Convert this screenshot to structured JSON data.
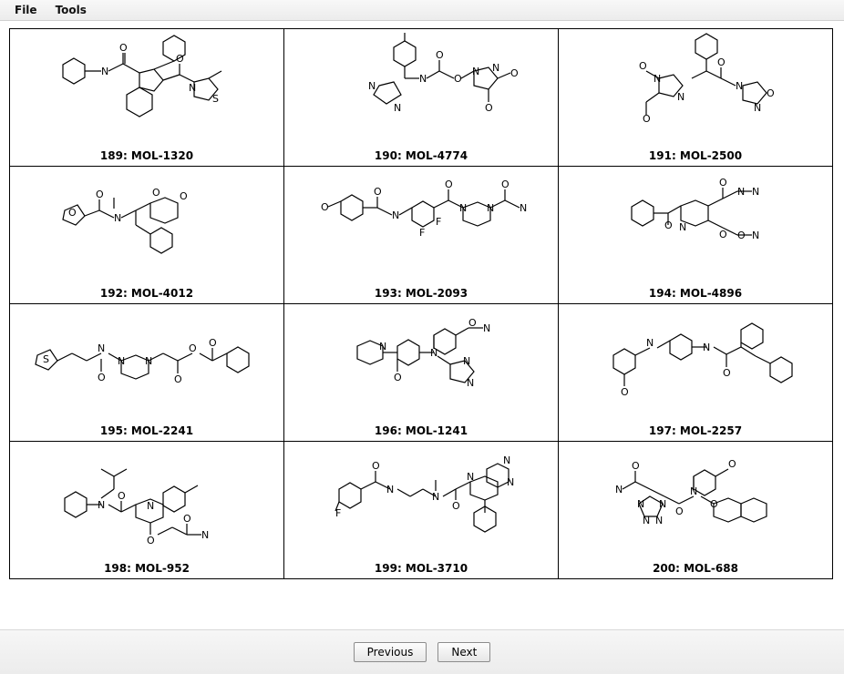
{
  "menubar": {
    "file_label": "File",
    "tools_label": "Tools"
  },
  "molecules": [
    {
      "index": 189,
      "id": "MOL-1320",
      "label": "189: MOL-1320"
    },
    {
      "index": 190,
      "id": "MOL-4774",
      "label": "190: MOL-4774"
    },
    {
      "index": 191,
      "id": "MOL-2500",
      "label": "191: MOL-2500"
    },
    {
      "index": 192,
      "id": "MOL-4012",
      "label": "192: MOL-4012"
    },
    {
      "index": 193,
      "id": "MOL-2093",
      "label": "193: MOL-2093"
    },
    {
      "index": 194,
      "id": "MOL-4896",
      "label": "194: MOL-4896"
    },
    {
      "index": 195,
      "id": "MOL-2241",
      "label": "195: MOL-2241"
    },
    {
      "index": 196,
      "id": "MOL-1241",
      "label": "196: MOL-1241"
    },
    {
      "index": 197,
      "id": "MOL-2257",
      "label": "197: MOL-2257"
    },
    {
      "index": 198,
      "id": "MOL-952",
      "label": "198: MOL-952"
    },
    {
      "index": 199,
      "id": "MOL-3710",
      "label": "199: MOL-3710"
    },
    {
      "index": 200,
      "id": "MOL-688",
      "label": "200: MOL-688"
    }
  ],
  "footer": {
    "previous_label": "Previous",
    "next_label": "Next"
  }
}
